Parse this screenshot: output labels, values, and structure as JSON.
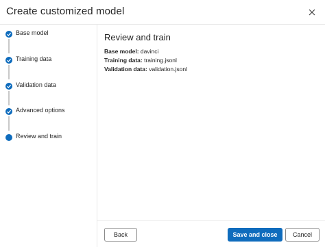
{
  "dialog": {
    "title": "Create customized model",
    "close_icon": "close-icon"
  },
  "steps": [
    {
      "label": "Base model",
      "state": "complete"
    },
    {
      "label": "Training data",
      "state": "complete"
    },
    {
      "label": "Validation data",
      "state": "complete"
    },
    {
      "label": "Advanced options",
      "state": "complete"
    },
    {
      "label": "Review and train",
      "state": "current"
    }
  ],
  "main": {
    "title": "Review and train",
    "details": [
      {
        "key": "Base model:",
        "value": "davinci"
      },
      {
        "key": "Training data:",
        "value": "training.jsonl"
      },
      {
        "key": "Validation data:",
        "value": "validation.jsonl"
      }
    ]
  },
  "footer": {
    "back_label": "Back",
    "save_label": "Save and close",
    "cancel_label": "Cancel"
  },
  "colors": {
    "accent": "#0f6cbd",
    "border": "#e6e6e6",
    "connector": "#c8c8c8"
  }
}
